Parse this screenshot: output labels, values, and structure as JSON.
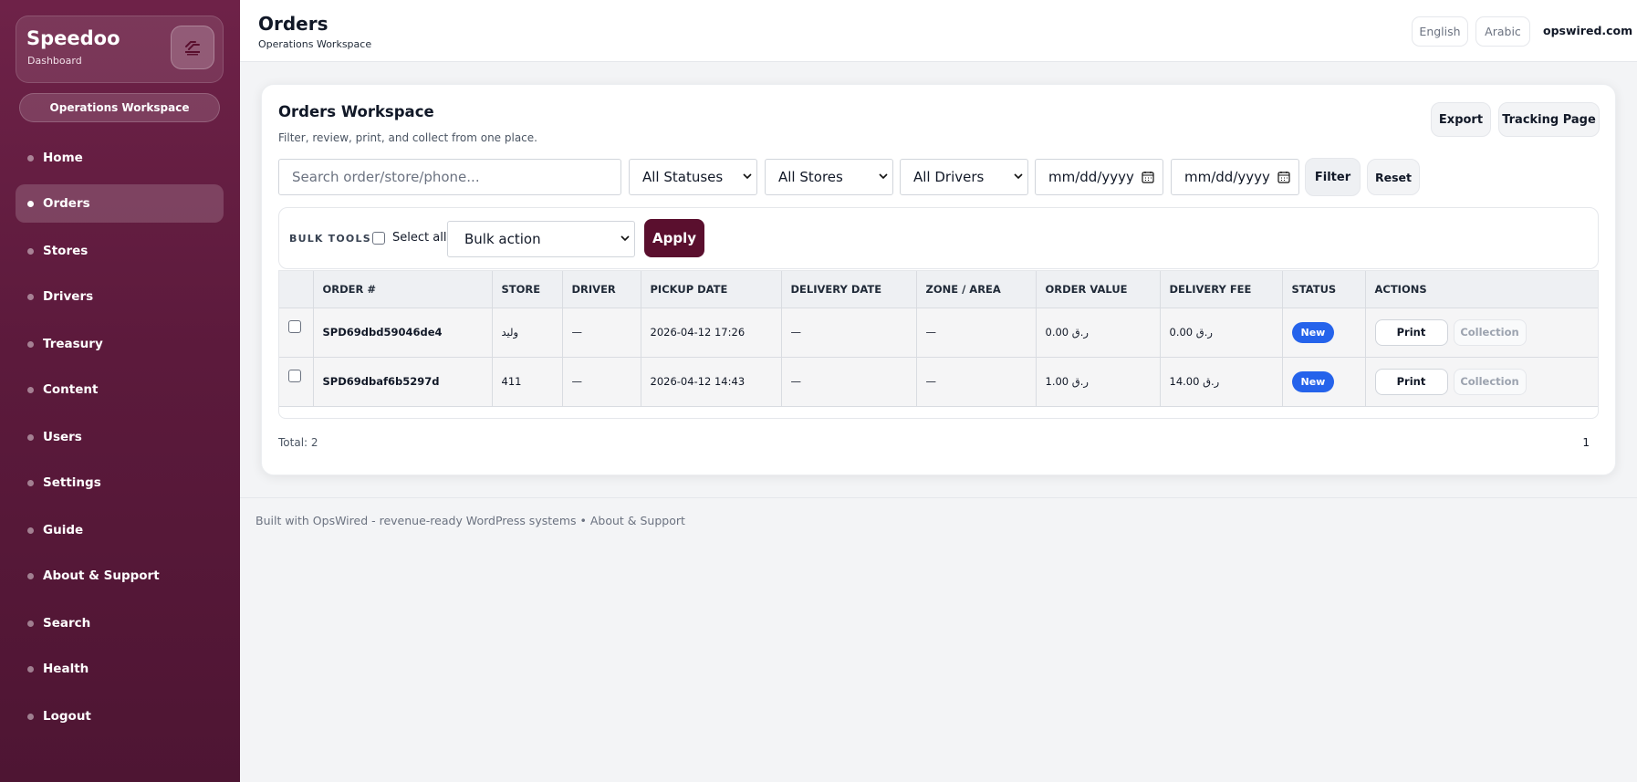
{
  "sidebar": {
    "brand_title": "Speedoo",
    "brand_sub": "Dashboard",
    "logo_icon": "speedoo-logo-icon",
    "workspace_pill": "Operations Workspace",
    "items": [
      {
        "label": "Home",
        "active": false
      },
      {
        "label": "Orders",
        "active": true
      },
      {
        "label": "Stores",
        "active": false
      },
      {
        "label": "Drivers",
        "active": false
      },
      {
        "label": "Treasury",
        "active": false
      },
      {
        "label": "Content",
        "active": false
      },
      {
        "label": "Users",
        "active": false
      },
      {
        "label": "Settings",
        "active": false
      },
      {
        "label": "Guide",
        "active": false
      },
      {
        "label": "About & Support",
        "active": false
      },
      {
        "label": "Search",
        "active": false
      },
      {
        "label": "Health",
        "active": false
      },
      {
        "label": "Logout",
        "active": false
      }
    ]
  },
  "header": {
    "title": "Orders",
    "subtitle": "Operations Workspace",
    "lang_english": "English",
    "lang_arabic": "Arabic",
    "domain": "opswired.com"
  },
  "card": {
    "title": "Orders Workspace",
    "subtitle": "Filter, review, print, and collect from one place.",
    "export_label": "Export",
    "tracking_label": "Tracking Page"
  },
  "filters": {
    "search_placeholder": "Search order/store/phone...",
    "status": "All Statuses",
    "stores": "All Stores",
    "drivers": "All Drivers",
    "date_from": "mm/dd/yyyy",
    "date_to": "mm/dd/yyyy",
    "filter_label": "Filter",
    "reset_label": "Reset"
  },
  "bulk": {
    "label": "BULK TOOLS",
    "select_all": "Select all",
    "action": "Bulk action",
    "apply": "Apply"
  },
  "table": {
    "headers": [
      "ORDER #",
      "STORE",
      "DRIVER",
      "PICKUP DATE",
      "DELIVERY DATE",
      "ZONE / AREA",
      "ORDER VALUE",
      "DELIVERY FEE",
      "STATUS",
      "ACTIONS"
    ],
    "rows": [
      {
        "order": "SPD69dbd59046de4",
        "store": "وليد",
        "driver": "—",
        "pickup": "2026-04-12 17:26",
        "delivery": "—",
        "zone": "—",
        "value": "0.00 ر.ق",
        "fee": "0.00 ر.ق",
        "status": "New",
        "print": "Print",
        "collection": "Collection"
      },
      {
        "order": "SPD69dbaf6b5297d",
        "store": "411",
        "driver": "—",
        "pickup": "2026-04-12 14:43",
        "delivery": "—",
        "zone": "—",
        "value": "1.00 ر.ق",
        "fee": "14.00 ر.ق",
        "status": "New",
        "print": "Print",
        "collection": "Collection"
      }
    ]
  },
  "summary": {
    "total": "Total: 2",
    "page": "1"
  },
  "footer": {
    "text": "Built with OpsWired - revenue-ready WordPress systems • About & Support"
  },
  "colors": {
    "sidebar": "#5c1a3c",
    "apply_button": "#5a0f2e",
    "status_badge": "#2563eb"
  }
}
